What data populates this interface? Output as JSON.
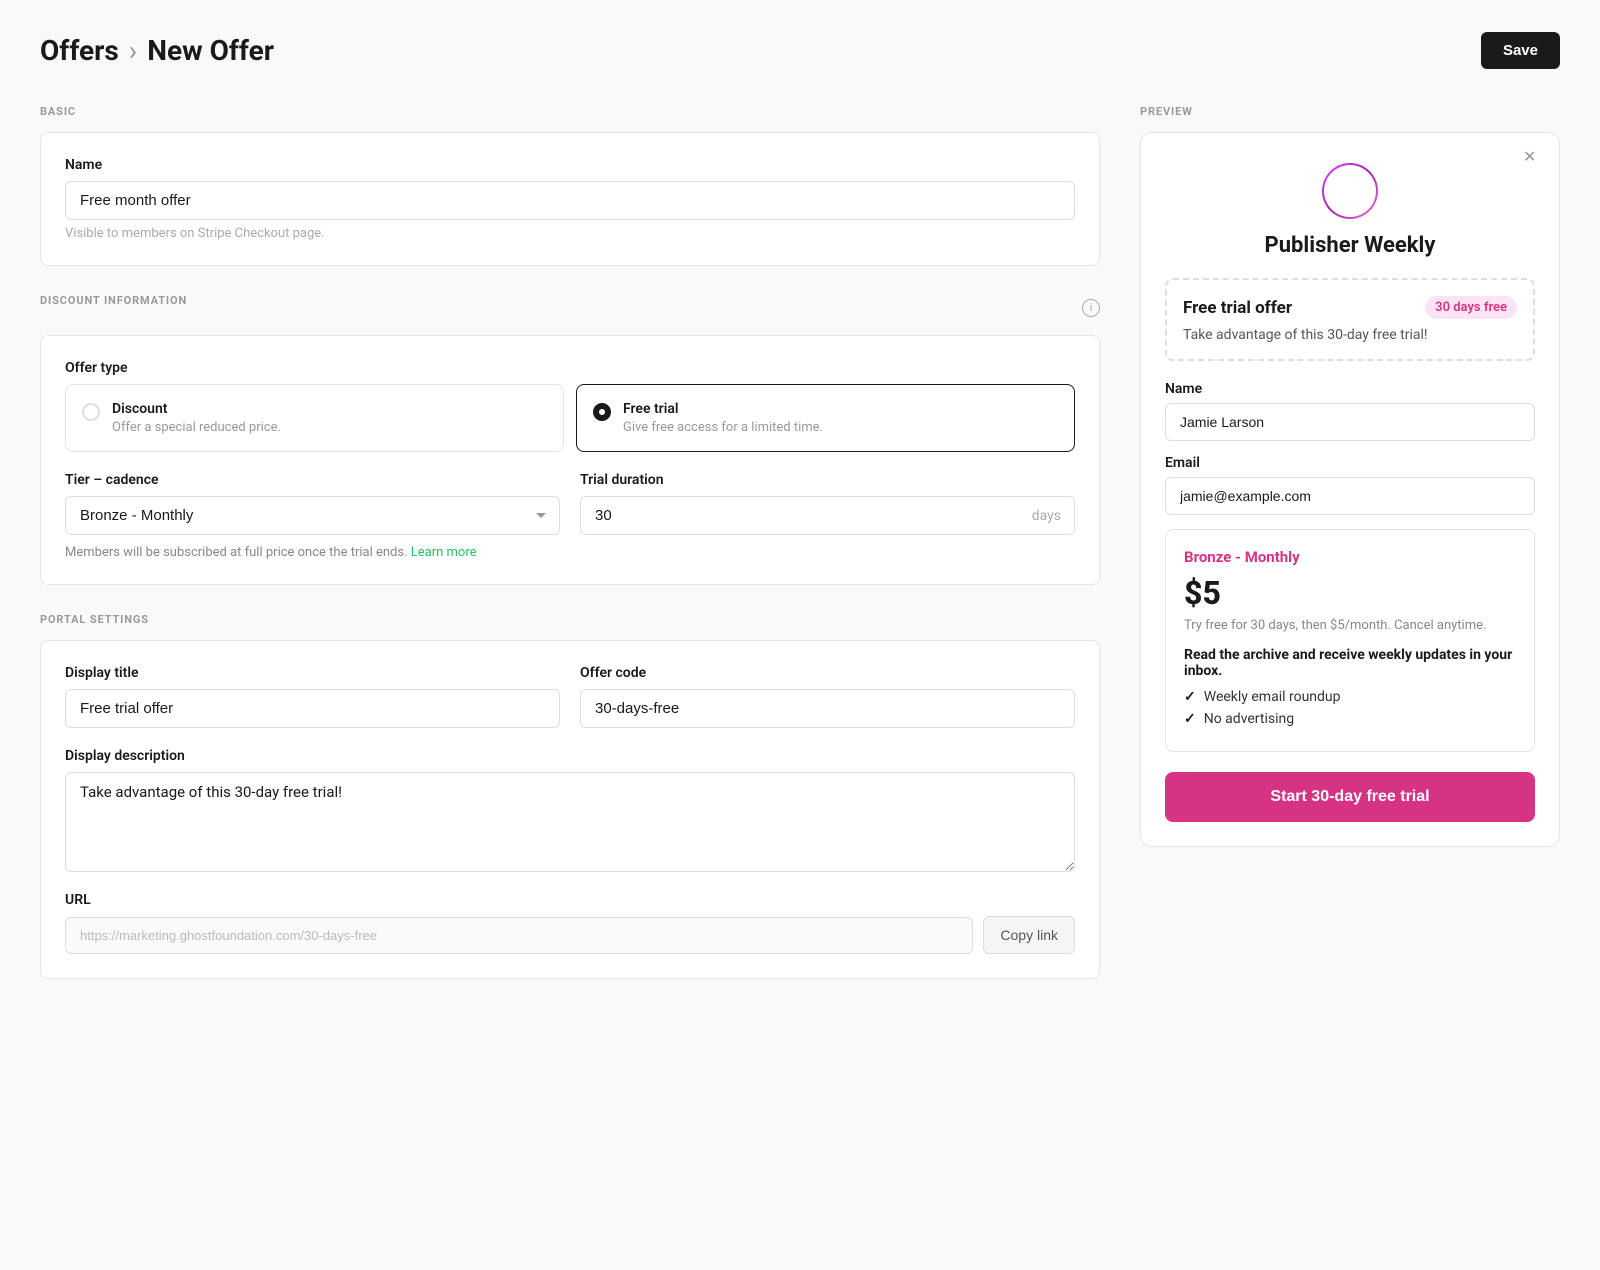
{
  "header": {
    "breadcrumb_parent": "Offers",
    "breadcrumb_sep": "›",
    "breadcrumb_current": "New Offer",
    "save_label": "Save"
  },
  "basic_section": {
    "section_label": "BASIC",
    "name_label": "Name",
    "name_value": "Free month offer",
    "name_hint": "Visible to members on Stripe Checkout page."
  },
  "discount_section": {
    "section_label": "DISCOUNT INFORMATION",
    "offer_type_label": "Offer type",
    "discount_title": "Discount",
    "discount_desc": "Offer a special reduced price.",
    "freetrial_title": "Free trial",
    "freetrial_desc": "Give free access for a limited time.",
    "tier_cadence_label": "Tier – cadence",
    "tier_cadence_value": "Bronze - Monthly",
    "trial_duration_label": "Trial duration",
    "trial_duration_value": "30",
    "trial_duration_unit": "days",
    "trial_note": "Members will be subscribed at full price once the trial ends.",
    "learn_more": "Learn more"
  },
  "portal_section": {
    "section_label": "PORTAL SETTINGS",
    "display_title_label": "Display title",
    "display_title_value": "Free trial offer",
    "offer_code_label": "Offer code",
    "offer_code_value": "30-days-free",
    "display_desc_label": "Display description",
    "display_desc_value": "Take advantage of this 30-day free trial!",
    "url_label": "URL",
    "url_value": "https://marketing.ghostfoundation.com/30-days-free",
    "copy_link_label": "Copy link"
  },
  "preview": {
    "section_label": "PREVIEW",
    "pub_name": "Publisher Weekly",
    "offer_box_title": "Free trial offer",
    "offer_badge": "30 days free",
    "offer_desc": "Take advantage of this 30-day free trial!",
    "name_label": "Name",
    "name_value": "Jamie Larson",
    "email_label": "Email",
    "email_value": "jamie@example.com",
    "tier_name": "Bronze - Monthly",
    "tier_price": "$5",
    "tier_trial_note": "Try free for 30 days, then $5/month. Cancel anytime.",
    "tier_desc": "Read the archive and receive weekly updates in your inbox.",
    "features": [
      "Weekly email roundup",
      "No advertising"
    ],
    "cta_label": "Start 30-day free trial"
  }
}
